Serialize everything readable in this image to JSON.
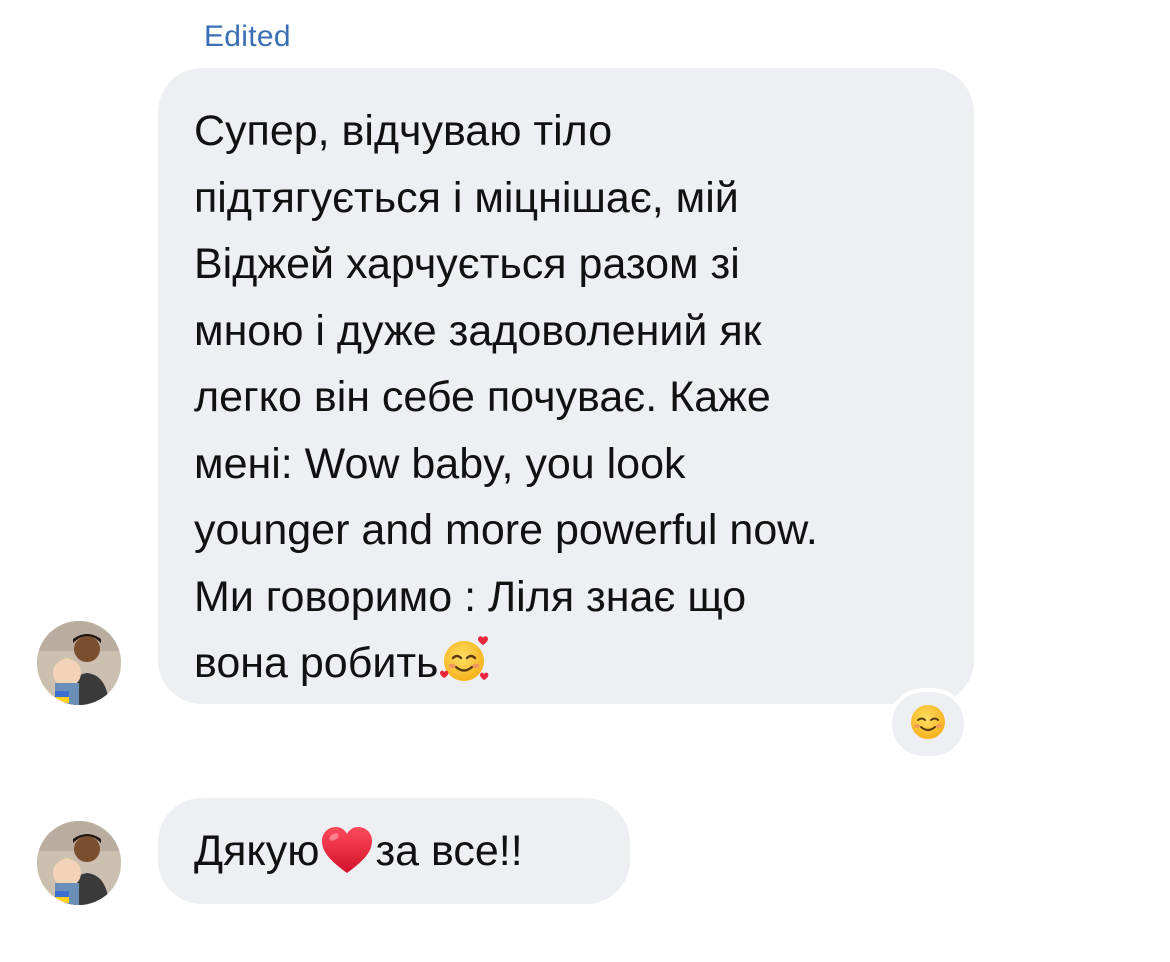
{
  "chat": {
    "edited_label": "Edited",
    "messages": [
      {
        "text": "Супер, відчуваю тіло\nпідтягується і міцнішає, мій\nВіджей харчується разом зі\nмною і дуже задоволений як\nлегко він себе почуває. Каже\nмені: Wow baby, you look\nyounger and more powerful now.\nМи говоримо : Ліля знає що\nвона робить",
        "trailing_emoji": "smiling-face-with-hearts-icon",
        "reaction": "smiling-face-icon"
      },
      {
        "text_before": "Дякую",
        "inline_emoji": "red-heart-icon",
        "text_after": "за все!!"
      }
    ]
  },
  "colors": {
    "bubble": "#eeeff3",
    "edited": "#3a6fb5",
    "text": "#111111"
  }
}
